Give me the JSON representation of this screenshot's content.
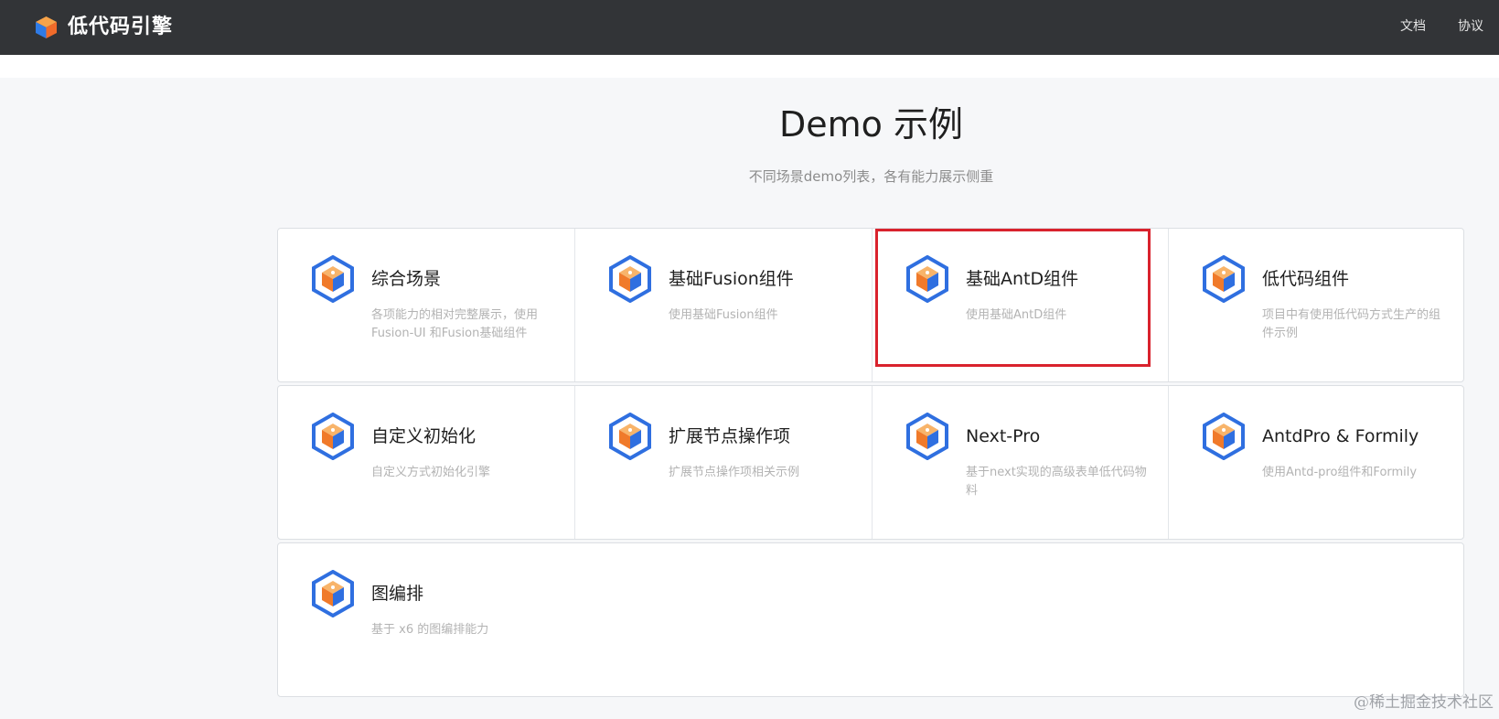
{
  "header": {
    "brand": "低代码引擎",
    "nav": [
      "文档",
      "协议"
    ]
  },
  "main": {
    "title": "Demo 示例",
    "subtitle": "不同场景demo列表，各有能力展示侧重"
  },
  "cards": [
    {
      "name": "综合场景",
      "desc": "各项能力的相对完整展示，使用Fusion-UI 和Fusion基础组件",
      "icon": "cube-icon"
    },
    {
      "name": "基础Fusion组件",
      "desc": "使用基础Fusion组件",
      "icon": "cube-icon"
    },
    {
      "name": "基础AntD组件",
      "desc": "使用基础AntD组件",
      "icon": "cube-icon",
      "highlighted": true
    },
    {
      "name": "低代码组件",
      "desc": "项目中有使用低代码方式生产的组件示例",
      "icon": "cube-icon"
    },
    {
      "name": "自定义初始化",
      "desc": "自定义方式初始化引擎",
      "icon": "cube-icon"
    },
    {
      "name": "扩展节点操作项",
      "desc": "扩展节点操作项相关示例",
      "icon": "cube-icon"
    },
    {
      "name": "Next-Pro",
      "desc": "基于next实现的高级表单低代码物料",
      "icon": "cube-icon"
    },
    {
      "name": "AntdPro & Formily",
      "desc": "使用Antd-pro组件和Formily",
      "icon": "cube-icon"
    },
    {
      "name": "图编排",
      "desc": "基于 x6 的图编排能力",
      "icon": "cube-icon"
    }
  ],
  "watermark": "@稀土掘金技术社区",
  "colors": {
    "header_bg": "#323437",
    "highlight": "#d9222d",
    "icon_blue": "#2f6fe0",
    "icon_orange": "#f07a2a"
  }
}
